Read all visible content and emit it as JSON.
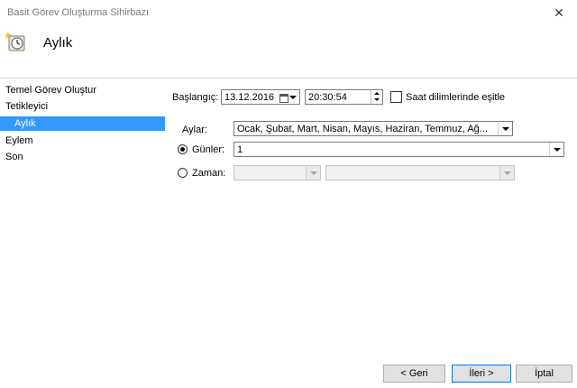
{
  "window": {
    "title": "Basit Görev Oluşturma Sihirbazı",
    "close_glyph": "✕"
  },
  "header": {
    "title": "Aylık",
    "icon": "task-clock-icon"
  },
  "sidebar": {
    "items": [
      {
        "label": "Temel Görev Oluştur"
      },
      {
        "label": "Tetikleyici"
      },
      {
        "label": "Aylık"
      },
      {
        "label": "Eylem"
      },
      {
        "label": "Son"
      }
    ],
    "selected": "Aylık"
  },
  "form": {
    "start_label": "Başlangıç:",
    "start_date": "13.12.2016",
    "start_time": "20:30:54",
    "sync_timezones_label": "Saat dilimlerinde eşitle",
    "sync_timezones_checked": false,
    "months_label": "Aylar:",
    "months_value": "Ocak, Şubat, Mart, Nisan, Mayıs, Haziran, Temmuz, Ağ...",
    "days_label": "Günler:",
    "days_value": "1",
    "days_selected": true,
    "on_label": "Zaman:",
    "on_selected": false
  },
  "buttons": {
    "back": "< Geri",
    "next": "İleri >",
    "cancel": "İptal"
  },
  "colors": {
    "selection": "#3399ff",
    "default_button_border": "#0078d7"
  }
}
